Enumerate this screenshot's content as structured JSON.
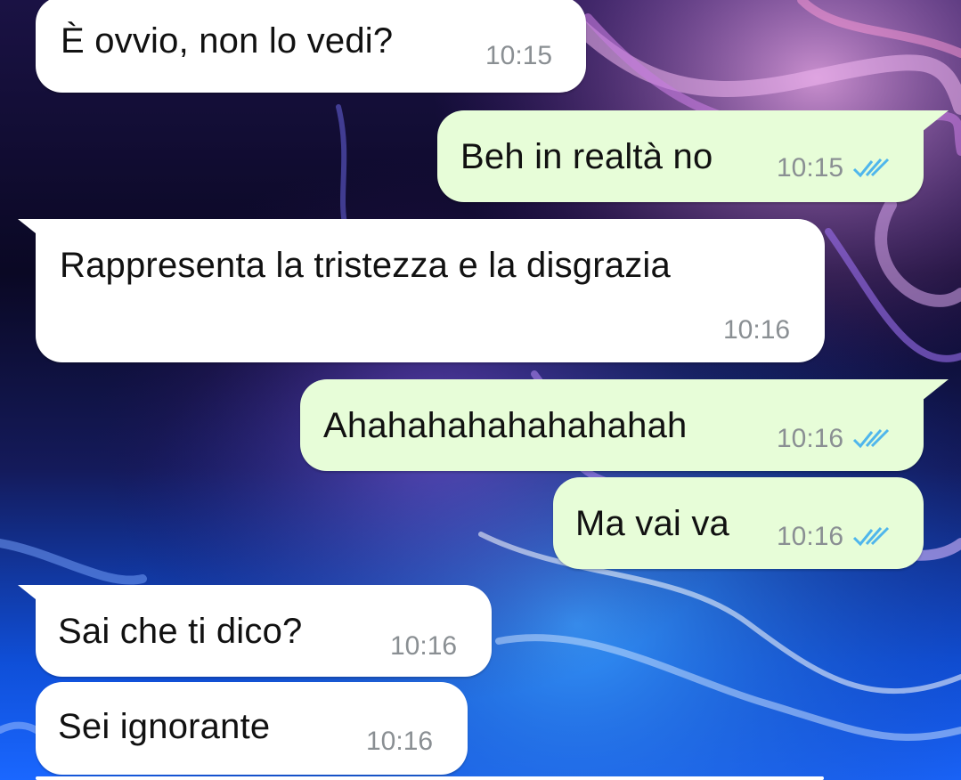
{
  "chat": {
    "messages": [
      {
        "id": "m1",
        "direction": "incoming",
        "text": "È ovvio, non lo vedi?",
        "time": "10:15",
        "status": ""
      },
      {
        "id": "m2",
        "direction": "outgoing",
        "text": "Beh in realtà no",
        "time": "10:15",
        "status": "read-double-tick-icon"
      },
      {
        "id": "m3",
        "direction": "incoming",
        "text": "Rappresenta la tristezza e la disgrazia",
        "time": "10:16",
        "status": ""
      },
      {
        "id": "m4",
        "direction": "outgoing",
        "text": "Ahahahahahahahahah",
        "time": "10:16",
        "status": "read-double-tick-icon"
      },
      {
        "id": "m5",
        "direction": "outgoing",
        "text": "Ma vai va",
        "time": "10:16",
        "status": "read-double-tick-icon"
      },
      {
        "id": "m6",
        "direction": "incoming",
        "text": "Sai che ti dico?",
        "time": "10:16",
        "status": ""
      },
      {
        "id": "m7",
        "direction": "incoming",
        "text": "Sei ignorante",
        "time": "10:16",
        "status": ""
      }
    ]
  },
  "colors": {
    "incoming_bubble": "#ffffff",
    "outgoing_bubble": "#e7fdd8",
    "read_ticks": "#4fb6ec",
    "timestamp": "#8a8f93"
  }
}
